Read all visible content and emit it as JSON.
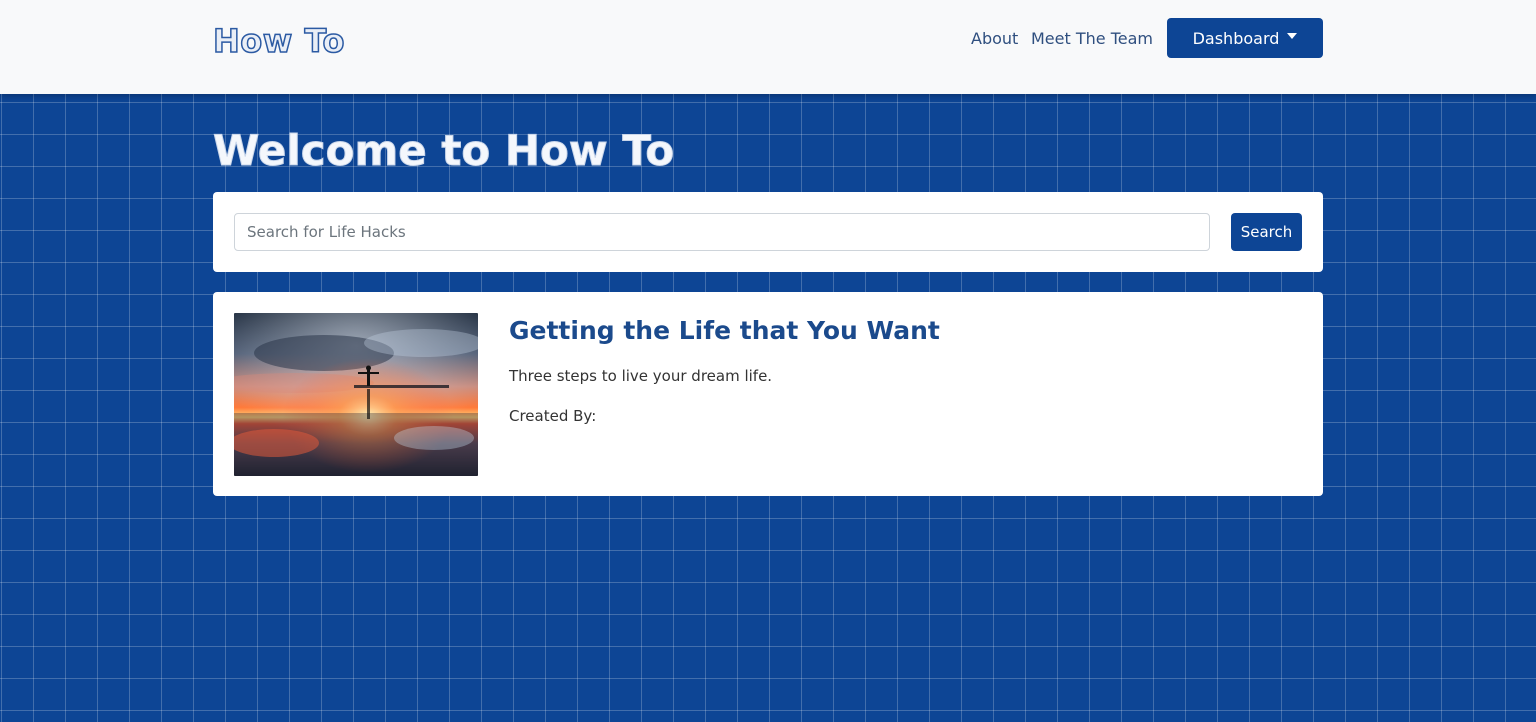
{
  "navbar": {
    "brand": "How To",
    "links": [
      {
        "label": "About"
      },
      {
        "label": "Meet The Team"
      }
    ],
    "dashboard_label": "Dashboard"
  },
  "hero": {
    "title": "Welcome to How To"
  },
  "search": {
    "placeholder": "Search for Life Hacks",
    "value": "",
    "button_label": "Search"
  },
  "posts": [
    {
      "title": "Getting the Life that You Want",
      "description": "Three steps to live your dream life.",
      "created_by_label": "Created By:"
    }
  ],
  "colors": {
    "primary": "#0d4595",
    "navbar_bg": "#f8f9fa",
    "grid_line": "rgba(255,255,255,0.22)"
  }
}
